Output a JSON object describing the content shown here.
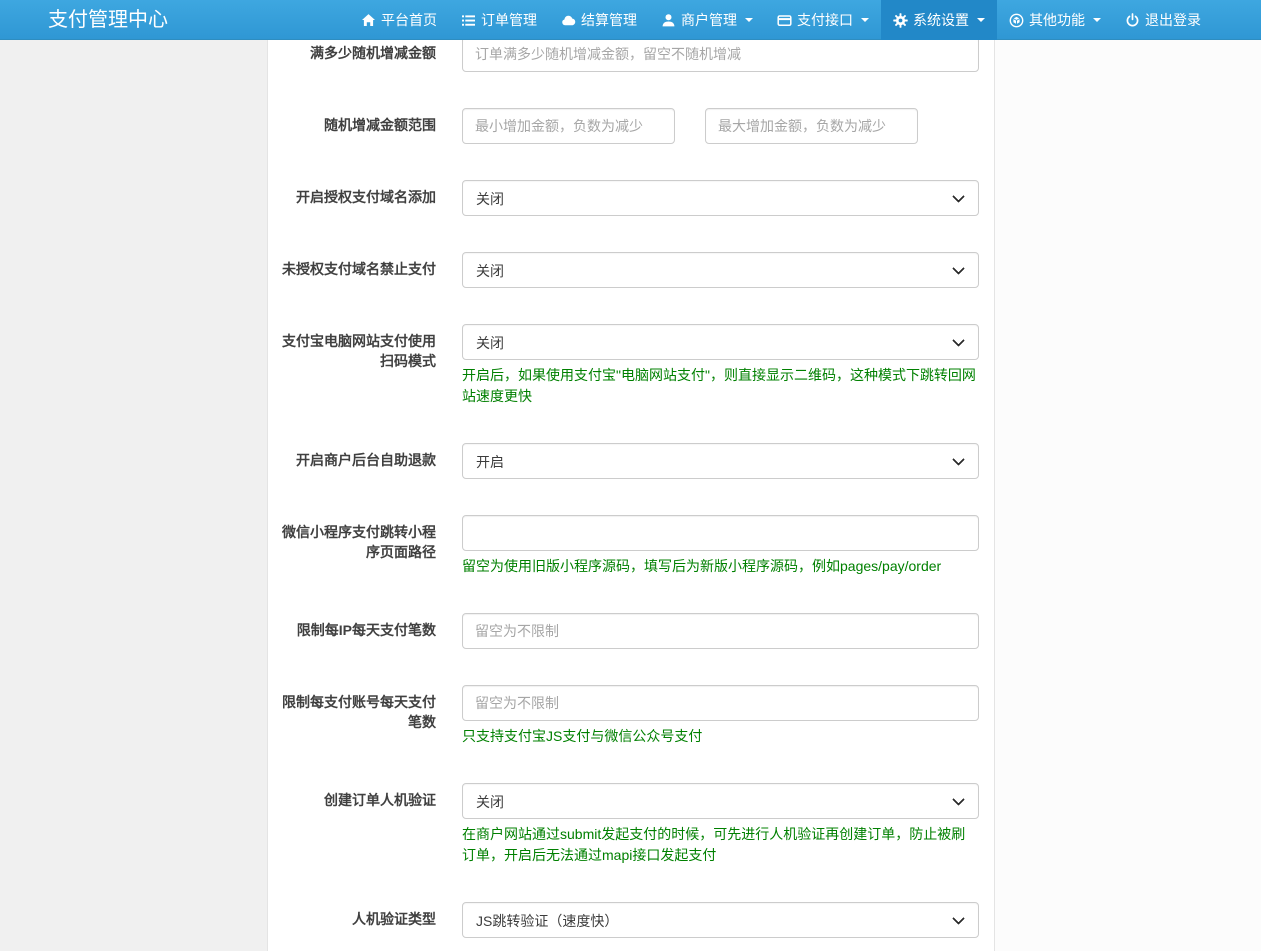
{
  "navbar": {
    "brand": "支付管理中心",
    "items": [
      {
        "name": "platform-home",
        "label": "平台首页",
        "icon": "home-icon",
        "caret": false,
        "active": false
      },
      {
        "name": "order-manage",
        "label": "订单管理",
        "icon": "list-icon",
        "caret": false,
        "active": false
      },
      {
        "name": "settle-manage",
        "label": "结算管理",
        "icon": "cloud-icon",
        "caret": false,
        "active": false
      },
      {
        "name": "merchant-manage",
        "label": "商户管理",
        "icon": "user-icon",
        "caret": true,
        "active": false
      },
      {
        "name": "pay-interface",
        "label": "支付接口",
        "icon": "credit-card-icon",
        "caret": true,
        "active": false
      },
      {
        "name": "system-settings",
        "label": "系统设置",
        "icon": "gear-icon",
        "caret": true,
        "active": true
      },
      {
        "name": "other-functions",
        "label": "其他功能",
        "icon": "cube-circle-icon",
        "caret": true,
        "active": false
      },
      {
        "name": "logout",
        "label": "退出登录",
        "icon": "power-icon",
        "caret": false,
        "active": false
      }
    ]
  },
  "colors": {
    "navbar_bg": "#2f97d4",
    "navbar_active_bg": "#2288c8",
    "help_text": "#008000",
    "panel_bg": "#ffffff",
    "page_bg_left": "#f0f0f0",
    "page_bg_right": "#fcfcfc"
  },
  "form": {
    "rows": [
      {
        "id": "random-amount-threshold",
        "label": "满多少随机增减金额",
        "type": "input",
        "placeholder": "订单满多少随机增减金额，留空不随机增减",
        "value": ""
      },
      {
        "id": "random-amount-range",
        "label": "随机增减金额范围",
        "type": "input2",
        "placeholders": [
          "最小增加金额，负数为减少",
          "最大增加金额，负数为减少"
        ],
        "values": [
          "",
          ""
        ]
      },
      {
        "id": "auth-pay-domain-add",
        "label": "开启授权支付域名添加",
        "type": "select",
        "value": "关闭"
      },
      {
        "id": "unauth-domain-block",
        "label": "未授权支付域名禁止支付",
        "type": "select",
        "value": "关闭"
      },
      {
        "id": "alipay-pc-qrcode-mode",
        "label": "支付宝电脑网站支付使用扫码模式",
        "type": "select",
        "value": "关闭",
        "help": "开启后，如果使用支付宝\"电脑网站支付\"，则直接显示二维码，这种模式下跳转回网站速度更快"
      },
      {
        "id": "merchant-self-refund",
        "label": "开启商户后台自助退款",
        "type": "select",
        "value": "开启"
      },
      {
        "id": "wxmini-page-path",
        "label": "微信小程序支付跳转小程序页面路径",
        "type": "input",
        "placeholder": "",
        "value": "",
        "help": "留空为使用旧版小程序源码，填写后为新版小程序源码，例如pages/pay/order"
      },
      {
        "id": "ip-daily-pay-limit",
        "label": "限制每IP每天支付笔数",
        "type": "input",
        "placeholder": "留空为不限制",
        "value": ""
      },
      {
        "id": "account-daily-pay-limit",
        "label": "限制每支付账号每天支付笔数",
        "type": "input",
        "placeholder": "留空为不限制",
        "value": "",
        "help": "只支持支付宝JS支付与微信公众号支付"
      },
      {
        "id": "order-captcha",
        "label": "创建订单人机验证",
        "type": "select",
        "value": "关闭",
        "help": "在商户网站通过submit发起支付的时候，可先进行人机验证再创建订单，防止被刷订单，开启后无法通过mapi接口发起支付"
      },
      {
        "id": "captcha-type",
        "label": "人机验证类型",
        "type": "select",
        "value": "JS跳转验证（速度快）"
      }
    ]
  }
}
